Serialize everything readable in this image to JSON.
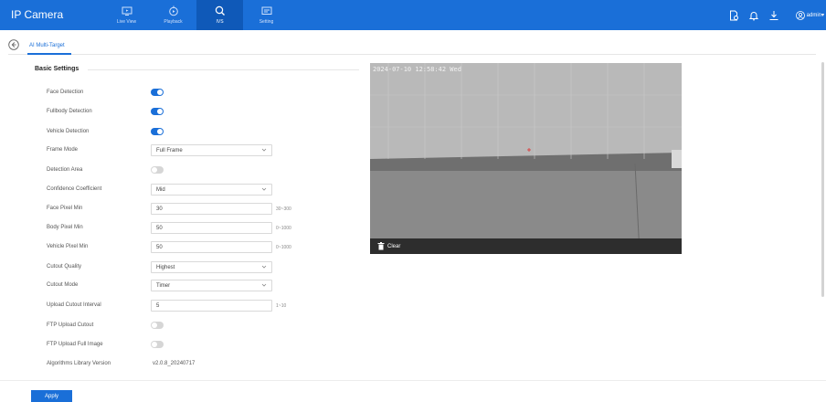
{
  "app": {
    "title": "IP Camera"
  },
  "nav": [
    {
      "label": "Live View",
      "icon": "monitor-icon"
    },
    {
      "label": "Playback",
      "icon": "playback-icon"
    },
    {
      "label": "IVS",
      "icon": "ivs-icon",
      "active": true
    },
    {
      "label": "Setting",
      "icon": "setting-icon"
    }
  ],
  "user": {
    "name": "admin"
  },
  "breadcrumb": {
    "tab": "AI Multi-Target"
  },
  "section": {
    "title": "Basic Settings"
  },
  "settings": {
    "face_detection": {
      "label": "Face Detection",
      "on": true
    },
    "fullbody_detection": {
      "label": "Fullbody Detection",
      "on": true
    },
    "vehicle_detection": {
      "label": "Vehicle Detection",
      "on": true
    },
    "frame_mode": {
      "label": "Frame Mode",
      "value": "Full Frame"
    },
    "detection_area": {
      "label": "Detection Area",
      "on": false
    },
    "confidence": {
      "label": "Confidence Coefficient",
      "value": "Mid"
    },
    "face_pixel_min": {
      "label": "Face Pixel Min",
      "value": "30",
      "range": "30~300"
    },
    "body_pixel_min": {
      "label": "Body Pixel Min",
      "value": "50",
      "range": "0~1000"
    },
    "vehicle_pixel_min": {
      "label": "Vehicle Pixel Min",
      "value": "50",
      "range": "0~1000"
    },
    "cutout_quality": {
      "label": "Cutout Quality",
      "value": "Highest"
    },
    "cutout_mode": {
      "label": "Cutout Mode",
      "value": "Timer"
    },
    "upload_interval": {
      "label": "Upload Cutout Interval",
      "value": "5",
      "range": "1~10"
    },
    "ftp_upload_cutout": {
      "label": "FTP Upload Cutout",
      "on": false
    },
    "ftp_upload_full": {
      "label": "FTP Upload Full Image",
      "on": false
    },
    "algo_version": {
      "label": "Algorithms Library Version",
      "value": "v2.0.8_20240717"
    }
  },
  "preview": {
    "osd_time": "2024-07-10 12:58:42 Wed",
    "clear_label": "Clear"
  },
  "footer": {
    "apply_label": "Apply"
  },
  "colors": {
    "accent": "#1a6fd8",
    "toggle_off": "#d6d6d6"
  }
}
